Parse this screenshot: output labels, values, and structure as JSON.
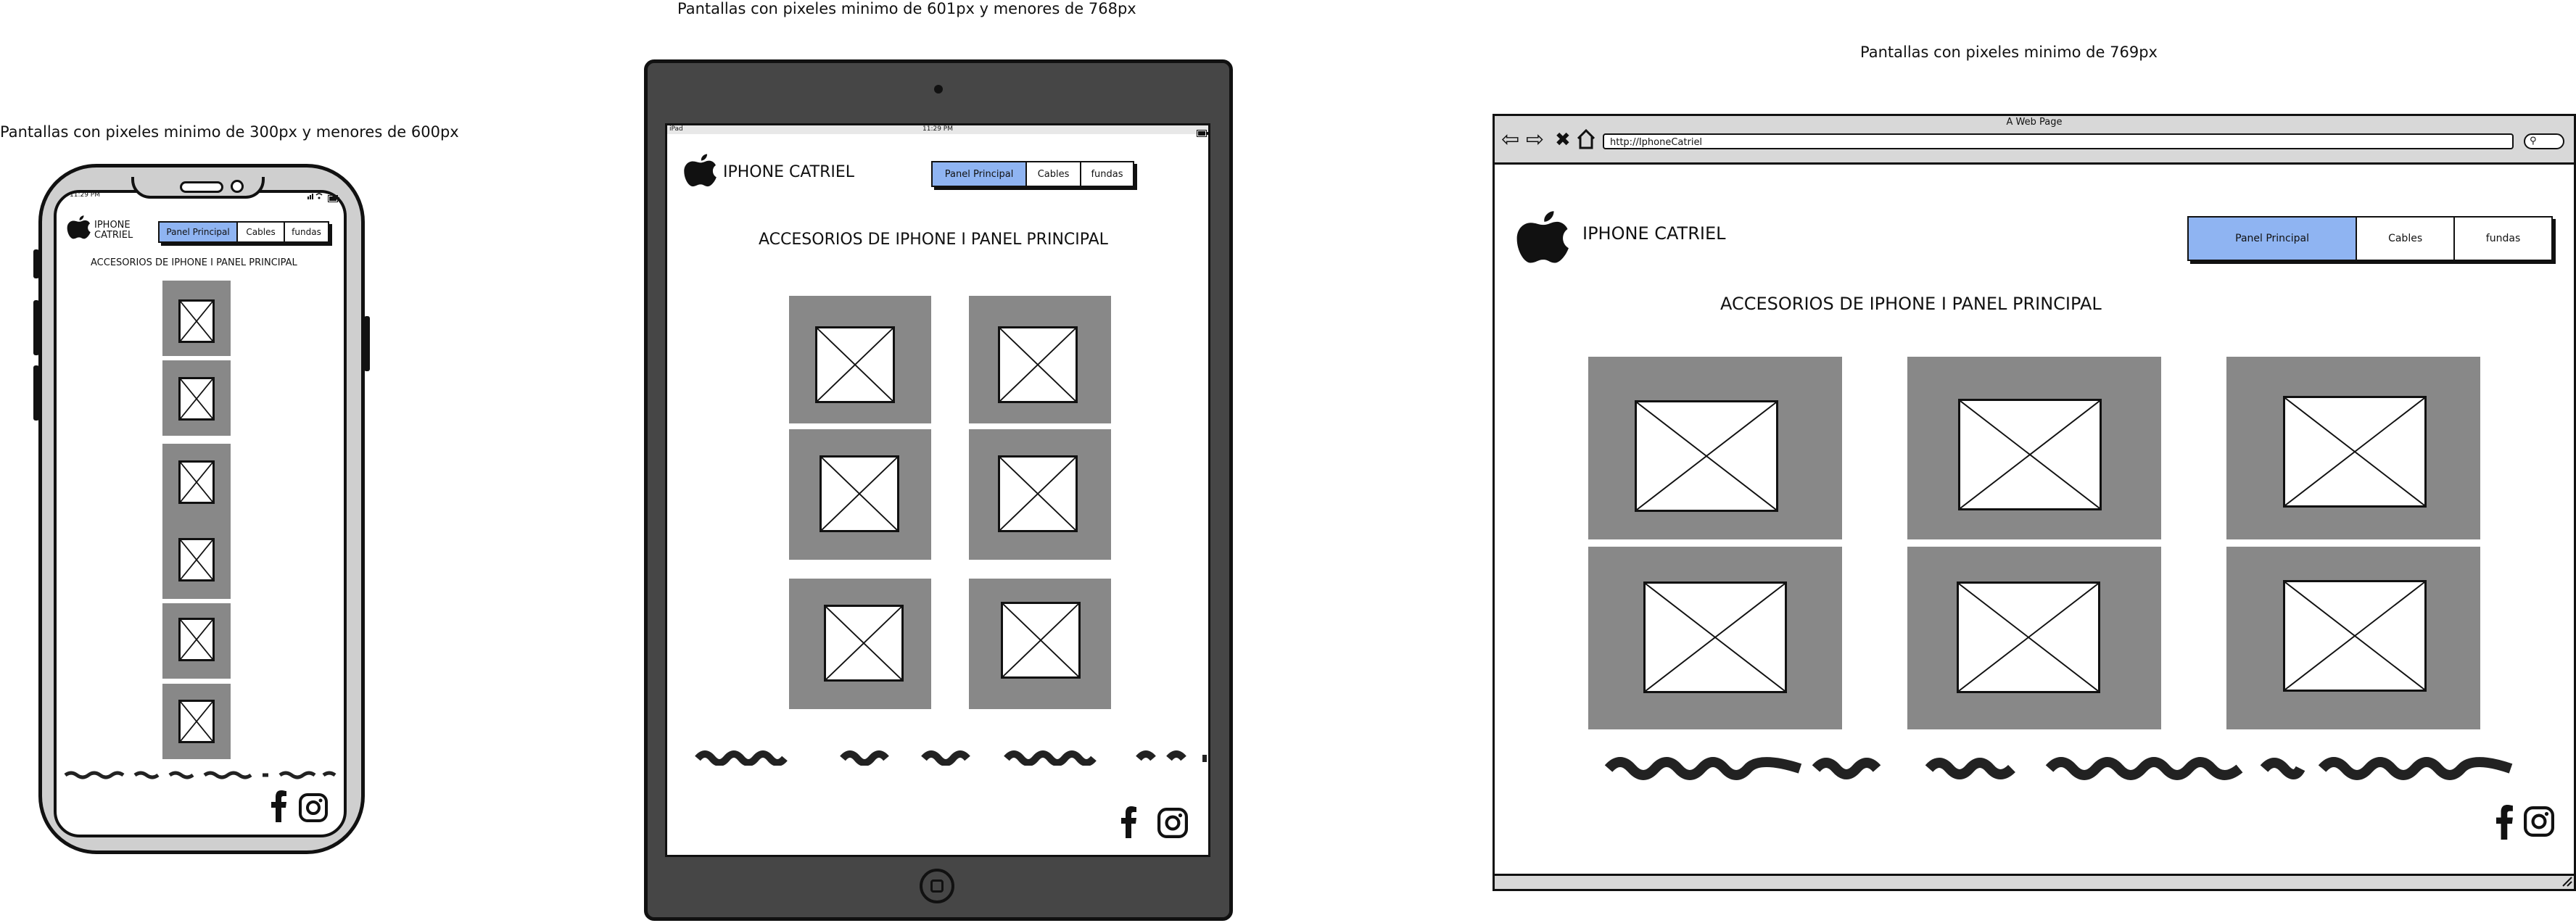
{
  "captions": {
    "phone": "Pantallas con pixeles minimo de 300px y menores de 600px",
    "tablet": "Pantallas con pixeles minimo de 601px y menores de 768px",
    "desktop": "Pantallas con pixeles minimo de 769px"
  },
  "site": {
    "brand_phone": "IPHONE\nCATRIEL",
    "brand": "IPHONE CATRIEL",
    "heading": "ACCESORIOS DE IPHONE I PANEL PRINCIPAL",
    "tabs": [
      "Panel Principal",
      "Cables",
      "fundas"
    ],
    "active_tab": "Panel Principal",
    "accent_color": "#8fb4f2",
    "placeholder_color": "#888888"
  },
  "phone": {
    "status_time": "11:29 PM"
  },
  "tablet": {
    "status_left": "iPad",
    "status_time": "11:29 PM"
  },
  "browser": {
    "title": "A Web Page",
    "url": "http://IphoneCatriel"
  },
  "icons": [
    "apple-logo-icon",
    "facebook-icon",
    "instagram-icon",
    "wifi-icon",
    "battery-icon",
    "back-arrow-icon",
    "forward-arrow-icon",
    "stop-icon",
    "home-icon",
    "search-icon"
  ]
}
